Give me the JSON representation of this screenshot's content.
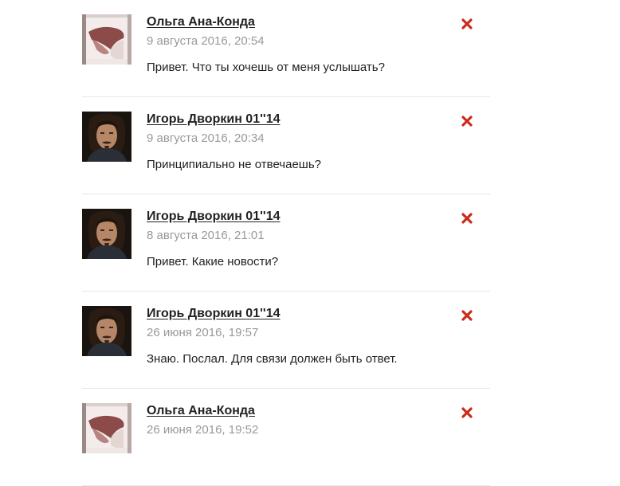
{
  "messages": [
    {
      "author": "Ольга Ана-Конда",
      "date": "9 августа 2016, 20:54",
      "text": "Привет. Что ты хочешь от меня услышать?",
      "avatar": "olga-avatar"
    },
    {
      "author": "Игорь Дворкин 01''14",
      "date": "9 августа 2016, 20:34",
      "text": "Принципиально не отвечаешь?",
      "avatar": "igor-avatar"
    },
    {
      "author": "Игорь Дворкин 01''14",
      "date": "8 августа 2016, 21:01",
      "text": "Привет. Какие новости?",
      "avatar": "igor-avatar"
    },
    {
      "author": "Игорь Дворкин 01''14",
      "date": "26 июня 2016, 19:57",
      "text": "Знаю. Послал. Для связи должен быть ответ.",
      "avatar": "igor-avatar"
    },
    {
      "author": "Ольга Ана-Конда",
      "date": "26 июня 2016, 19:52",
      "text": "",
      "avatar": "olga-avatar"
    }
  ],
  "colors": {
    "delete_icon": "#cc2a1a",
    "date_text": "#999999",
    "divider": "#e8e8e8"
  },
  "icons": {
    "delete": "close-icon"
  }
}
